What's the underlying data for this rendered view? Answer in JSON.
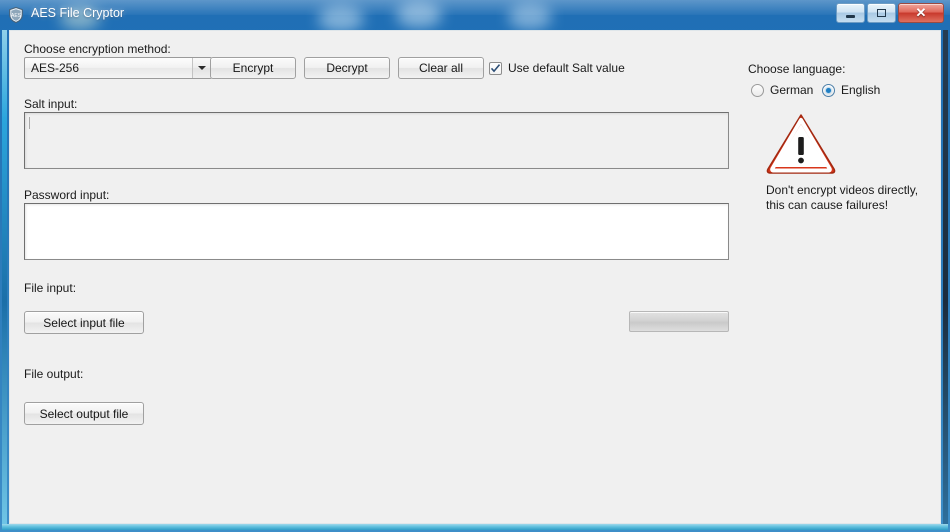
{
  "window": {
    "title": "AES File Cryptor",
    "icon": "shield-icon",
    "minimize_label": "Minimize",
    "maximize_label": "Maximize",
    "close_label": "✕"
  },
  "form": {
    "method_label": "Choose encryption method:",
    "method_value": "AES-256",
    "encrypt_label": "Encrypt",
    "decrypt_label": "Decrypt",
    "clear_label": "Clear all",
    "salt_checkbox_label": "Use default Salt value",
    "salt_checkbox_checked": true,
    "salt_label": "Salt input:",
    "salt_value": "",
    "password_label": "Password input:",
    "password_value": "",
    "file_input_label": "File input:",
    "select_input_label": "Select input file",
    "file_output_label": "File output:",
    "select_output_label": "Select output file",
    "progress_value": ""
  },
  "language": {
    "label": "Choose language:",
    "german_label": "German",
    "english_label": "English",
    "selected": "English"
  },
  "warning": {
    "icon": "warning-triangle-icon",
    "text": "Don't encrypt videos directly,\nthis can cause failures!"
  },
  "colors": {
    "titlebar_blue": "#2878b8",
    "close_red": "#c8392c",
    "warning_red": "#d8361b",
    "radio_blue": "#1f7fc4",
    "client_bg": "#f0f0f0"
  }
}
